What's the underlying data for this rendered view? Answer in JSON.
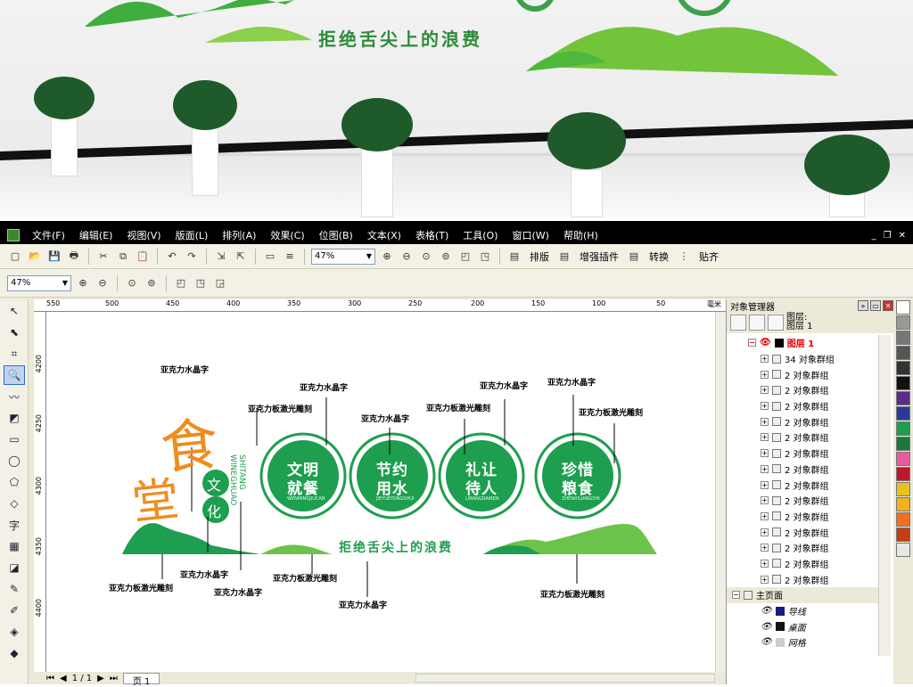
{
  "photo": {
    "slogan": "拒绝舌尖上的浪费"
  },
  "menu": [
    "文件(F)",
    "编辑(E)",
    "视图(V)",
    "版面(L)",
    "排列(A)",
    "效果(C)",
    "位图(B)",
    "文本(X)",
    "表格(T)",
    "工具(O)",
    "窗口(W)",
    "帮助(H)"
  ],
  "toolbar": {
    "zoom": "47%",
    "layout": "排版",
    "plugin": "增强插件",
    "convert": "转换",
    "snap": "贴齐"
  },
  "toolbar2": {
    "zoom": "47%"
  },
  "ruler_h": [
    "550",
    "500",
    "450",
    "400",
    "350",
    "300",
    "250",
    "200",
    "150",
    "100",
    "50",
    "毫米"
  ],
  "ruler_v": [
    "4200",
    "4250",
    "4300",
    "4350",
    "4400"
  ],
  "design": {
    "food": "食",
    "hall": "堂",
    "culture1": "文",
    "culture2": "化",
    "pinyin": "SHITANG WINEGHUAO",
    "circles": [
      {
        "line1": "文明",
        "line2": "就餐",
        "pinyin": "WENMINGJIUCAN"
      },
      {
        "line1": "节约",
        "line2": "用水",
        "pinyin": "JIEYUEYONGSHUI"
      },
      {
        "line1": "礼让",
        "line2": "待人",
        "pinyin": "LIRANGDAIREN"
      },
      {
        "line1": "珍惜",
        "line2": "粮食",
        "pinyin": "ZHENXILIANGSHI"
      }
    ],
    "slogan": "拒绝舌尖上的浪费",
    "labels": {
      "acrylic": "亚克力水晶字",
      "laser": "亚克力板激光雕刻"
    }
  },
  "statusbar": {
    "pages": "1 / 1",
    "page_tab": "页 1"
  },
  "panel": {
    "title": "对象管理器",
    "layer_label": "图层:",
    "layer_name": "图层 1",
    "layer1": "图层 1",
    "groups": [
      "34 对象群组",
      "2 对象群组",
      "2 对象群组",
      "2 对象群组",
      "2 对象群组",
      "2 对象群组",
      "2 对象群组",
      "2 对象群组",
      "2 对象群组",
      "2 对象群组",
      "2 对象群组",
      "2 对象群组",
      "2 对象群组",
      "2 对象群组",
      "2 对象群组"
    ],
    "master": "主页面",
    "sublayers": [
      "导线",
      "桌面",
      "网格"
    ]
  },
  "colors": {
    "green": "#1e9e4f",
    "lightgreen": "#6cc24a",
    "orange": "#f08c1e"
  }
}
